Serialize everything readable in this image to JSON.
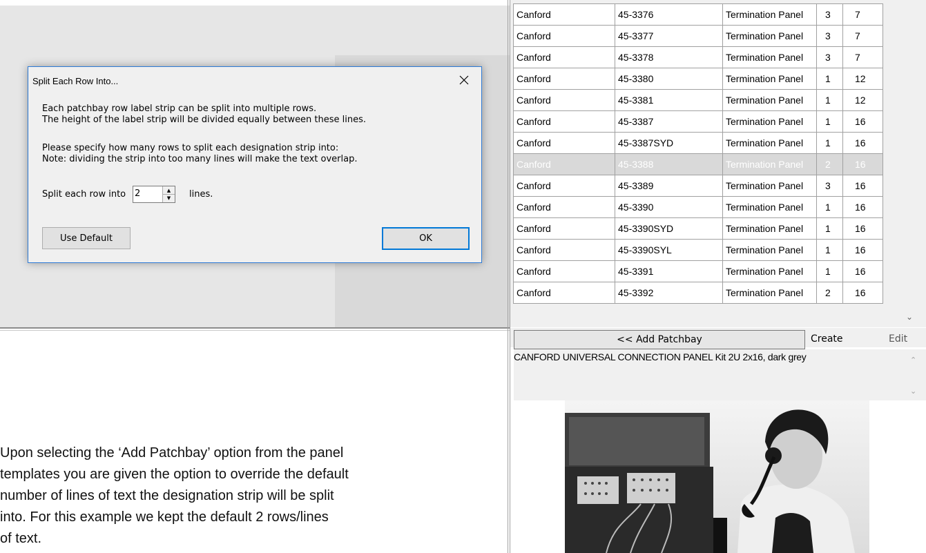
{
  "dialog": {
    "title": "Split Each Row Into...",
    "line1": "Each patchbay row label strip can be split into multiple rows.",
    "line2": "The height of the label strip will be divided equally between these lines.",
    "line3": "Please specify how many rows to split each designation strip into:",
    "line4": "Note: dividing the strip into too many lines will make the text overlap.",
    "split_label": "Split each row into",
    "split_value": "2",
    "lines_label": "lines.",
    "use_default_label": "Use Default",
    "ok_label": "OK"
  },
  "caption": {
    "line1": "Upon selecting the ‘Add Patchbay’ option from the panel",
    "line2": "templates you are given the option to override the default",
    "line3": "number of lines of text the designation strip will be split",
    "line4": "into.  For this example we kept the default 2 rows/lines",
    "line5": "of text."
  },
  "grid": {
    "rows": [
      {
        "maker": "Canford",
        "part": "45-3376",
        "type": "Termination Panel",
        "u": "3",
        "ways": "7"
      },
      {
        "maker": "Canford",
        "part": "45-3377",
        "type": "Termination Panel",
        "u": "3",
        "ways": "7"
      },
      {
        "maker": "Canford",
        "part": "45-3378",
        "type": "Termination Panel",
        "u": "3",
        "ways": "7"
      },
      {
        "maker": "Canford",
        "part": "45-3380",
        "type": "Termination Panel",
        "u": "1",
        "ways": "12"
      },
      {
        "maker": "Canford",
        "part": "45-3381",
        "type": "Termination Panel",
        "u": "1",
        "ways": "12"
      },
      {
        "maker": "Canford",
        "part": "45-3387",
        "type": "Termination Panel",
        "u": "1",
        "ways": "16"
      },
      {
        "maker": "Canford",
        "part": "45-3387SYD",
        "type": "Termination Panel",
        "u": "1",
        "ways": "16"
      },
      {
        "maker": "Canford",
        "part": "45-3388",
        "type": "Termination Panel",
        "u": "2",
        "ways": "16",
        "selected": true
      },
      {
        "maker": "Canford",
        "part": "45-3389",
        "type": "Termination Panel",
        "u": "3",
        "ways": "16"
      },
      {
        "maker": "Canford",
        "part": "45-3390",
        "type": "Termination Panel",
        "u": "1",
        "ways": "16"
      },
      {
        "maker": "Canford",
        "part": "45-3390SYD",
        "type": "Termination Panel",
        "u": "1",
        "ways": "16"
      },
      {
        "maker": "Canford",
        "part": "45-3390SYL",
        "type": "Termination Panel",
        "u": "1",
        "ways": "16"
      },
      {
        "maker": "Canford",
        "part": "45-3391",
        "type": "Termination Panel",
        "u": "1",
        "ways": "16"
      },
      {
        "maker": "Canford",
        "part": "45-3392",
        "type": "Termination Panel",
        "u": "2",
        "ways": "16"
      }
    ]
  },
  "toolbar": {
    "add_patchbay_label": "<< Add Patchbay",
    "create_label": "Create",
    "edit_label": "Edit"
  },
  "description": "CANFORD UNIVERSAL CONNECTION PANEL Kit 2U 2x16, dark grey",
  "icons": {
    "close": "close-icon",
    "spin_up": "spin-up-icon",
    "spin_down": "spin-down-icon",
    "scroll_down": "chevron-down-icon"
  },
  "colors": {
    "dialog_border": "#2b79d6",
    "ok_border": "#0078d7",
    "selected_row": "#d9d9d9"
  }
}
